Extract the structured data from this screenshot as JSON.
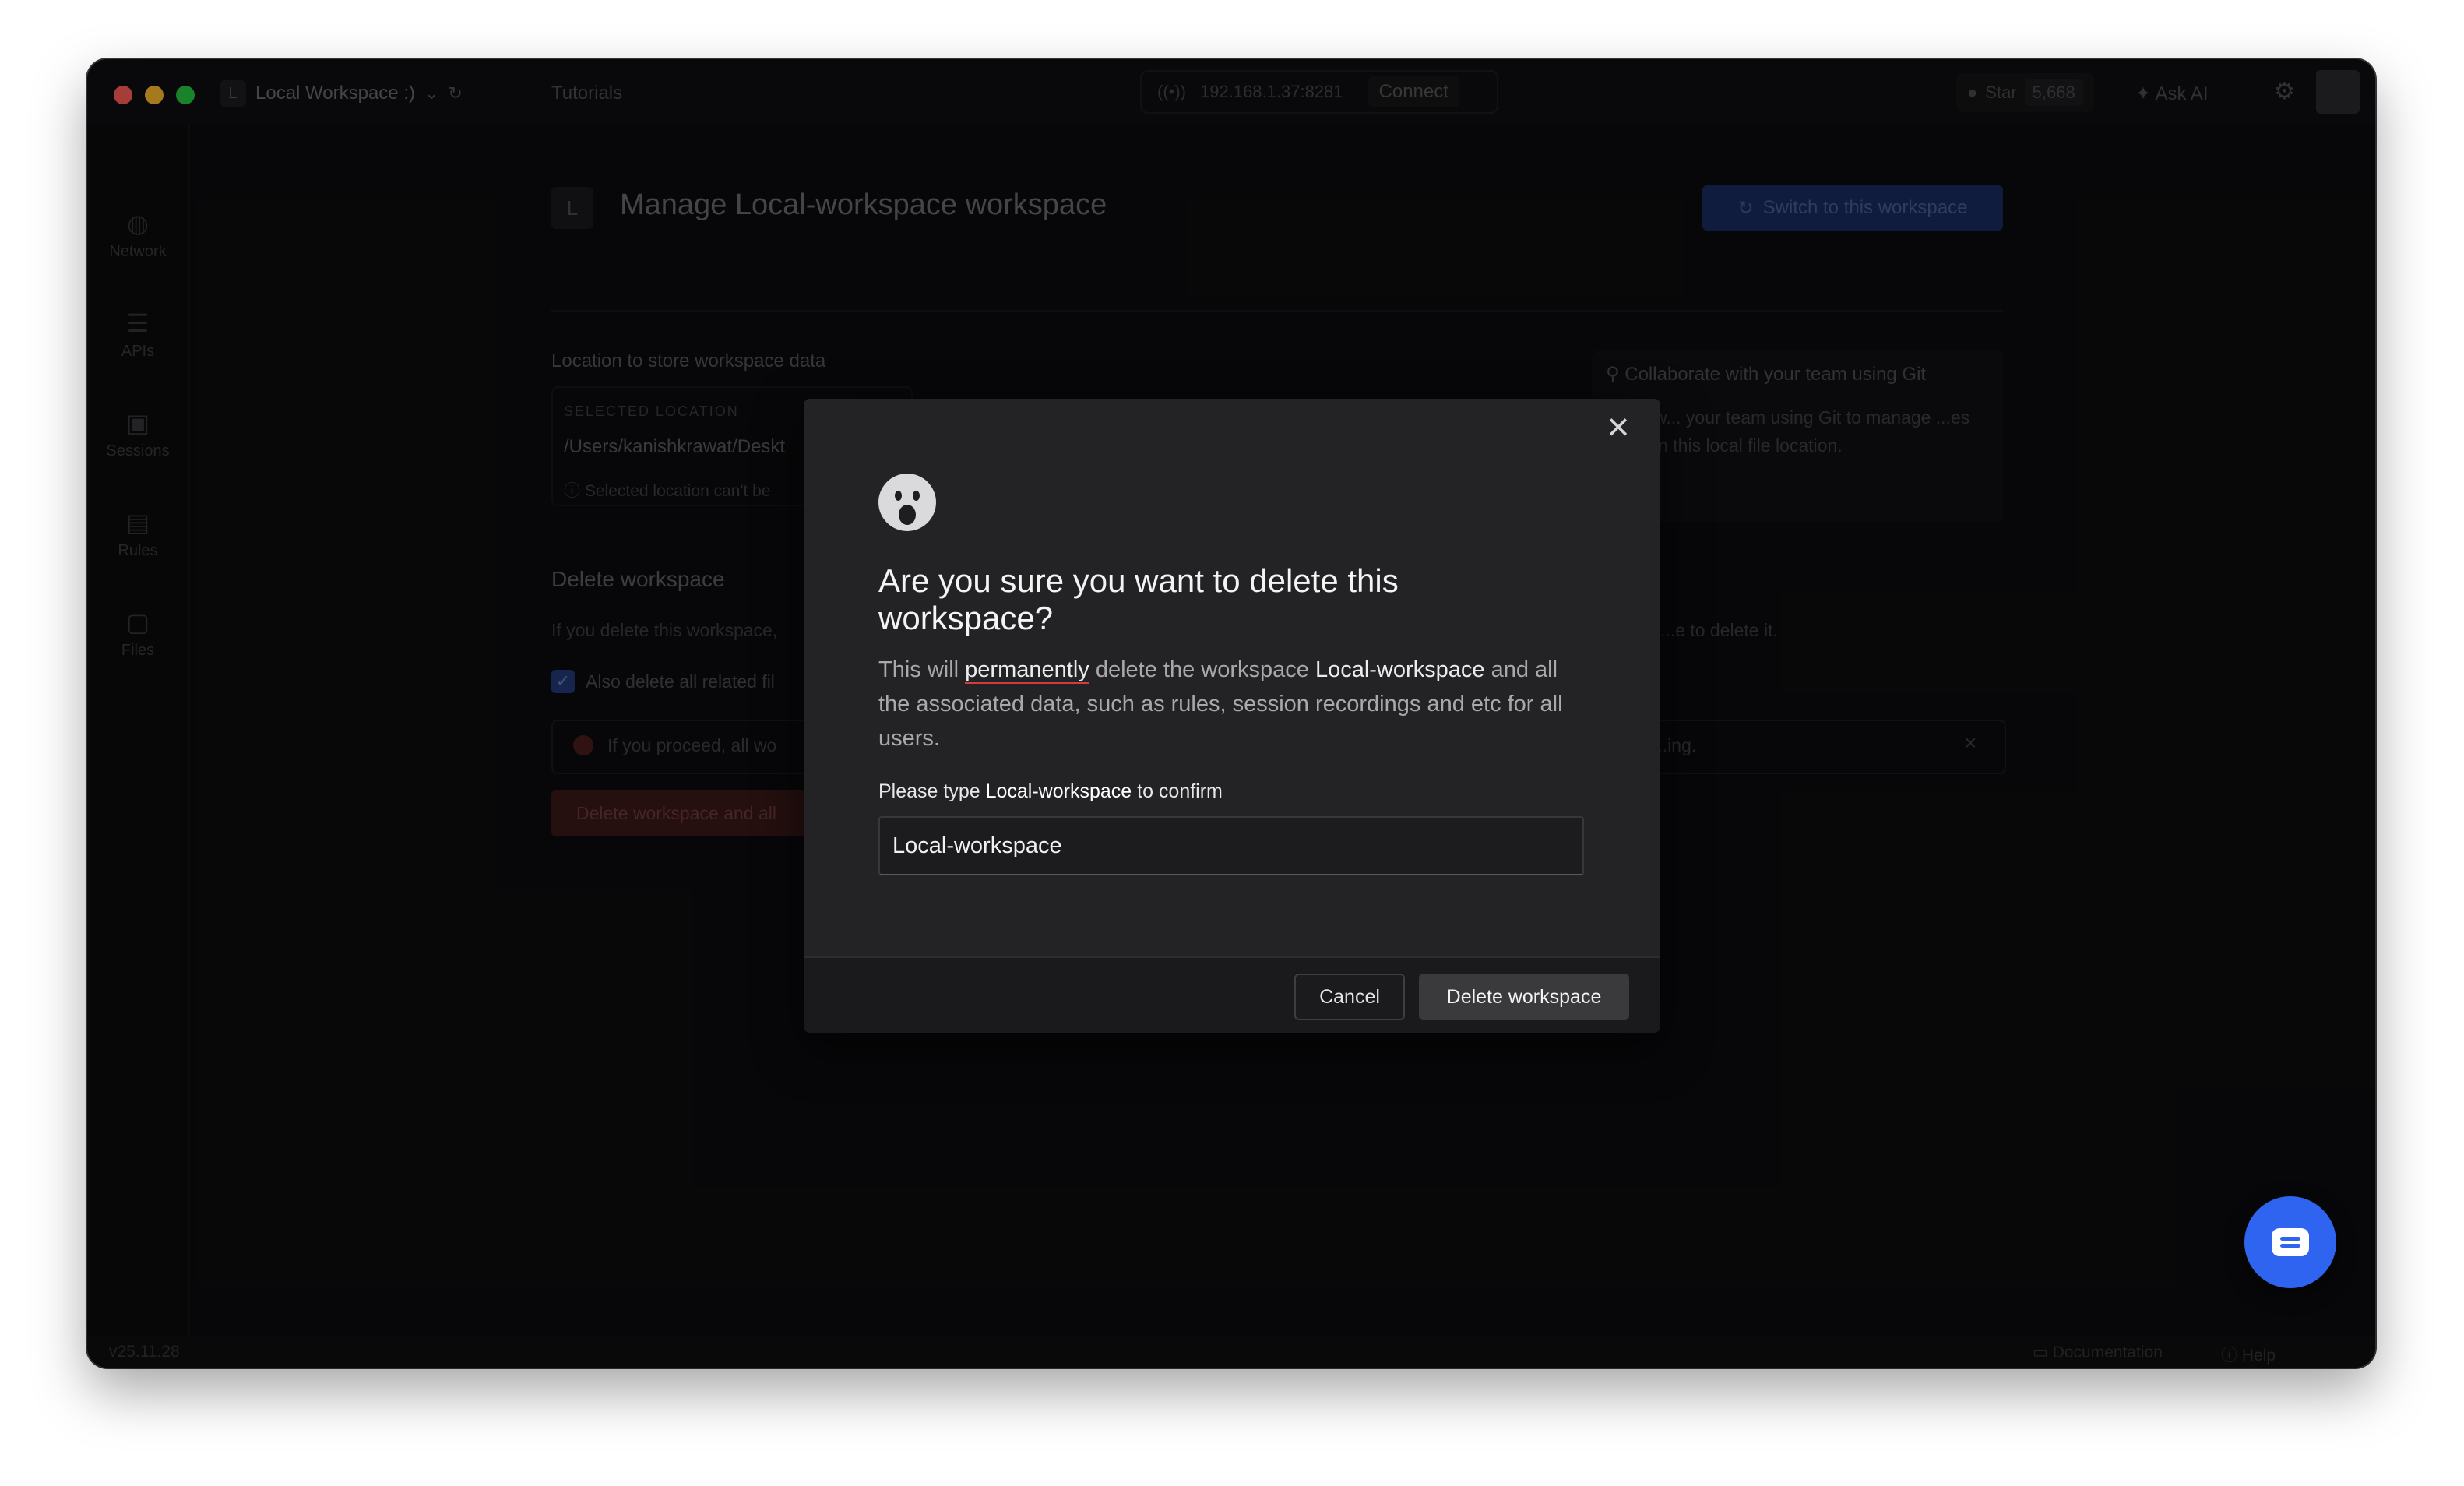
{
  "titlebar": {
    "workspace_badge": "L",
    "workspace_name": "Local Workspace :)",
    "tutorials": "Tutorials",
    "ip_address": "192.168.1.37:8281",
    "connect": "Connect",
    "star_label": "Star",
    "star_count": "5,668",
    "ask_ai": "Ask AI"
  },
  "sidebar": {
    "items": [
      {
        "label": "Network"
      },
      {
        "label": "APIs"
      },
      {
        "label": "Sessions"
      },
      {
        "label": "Rules"
      },
      {
        "label": "Files"
      }
    ]
  },
  "main": {
    "badge": "L",
    "title": "Manage Local-workspace workspace",
    "switch_button": "Switch to this workspace",
    "location_label": "Location to store workspace data",
    "selected_location_caption": "SELECTED LOCATION",
    "selected_location_path": "/Users/kanishkrawat/Deskt",
    "location_note": "Selected location can't be",
    "collab_title": "Collaborate with your team using Git",
    "collab_text": "w... your team using Git to manage ...es in this local file location.",
    "delete_heading": "Delete workspace",
    "delete_desc": "If you delete this workspace,",
    "delete_desc_right": "...e to delete it.",
    "also_delete_label": "Also delete all related fil",
    "warning_text": "If you proceed, all wo",
    "warning_text_right": "...ing.",
    "delete_button": "Delete workspace and all"
  },
  "footer": {
    "version": "v25.11.28",
    "documentation": "Documentation",
    "help": "Help"
  },
  "modal": {
    "title": "Are you sure you want to delete this workspace?",
    "text_prefix": "This will ",
    "text_permanently": "permanently",
    "text_mid": " delete the workspace ",
    "text_workspace": "Local-workspace",
    "text_suffix": " and all the associated data, such as rules, session recordings and etc for all users.",
    "confirm_prefix": "Please type ",
    "confirm_name": "Local-workspace",
    "confirm_suffix": " to confirm",
    "input_value": "Local-workspace",
    "cancel_label": "Cancel",
    "delete_label": "Delete workspace"
  },
  "colors": {
    "accent_blue": "#2f64f0",
    "modal_bg": "#232325",
    "danger_underline": "#d23c3c"
  }
}
